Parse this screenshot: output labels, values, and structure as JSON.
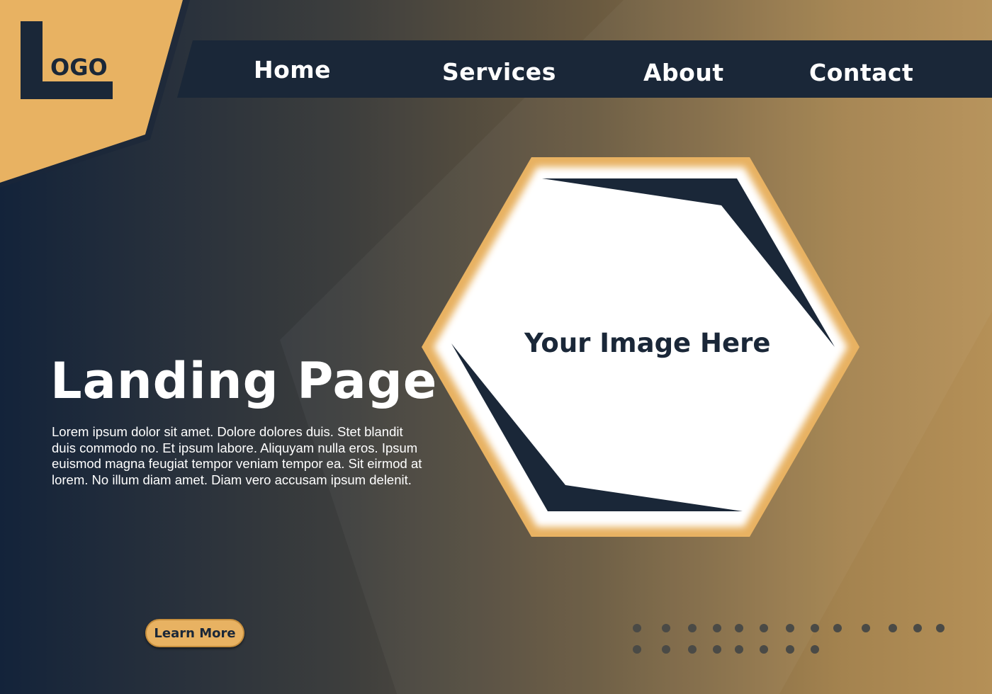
{
  "logo": {
    "text": "OGO",
    "alt": "Logo"
  },
  "nav": {
    "items": [
      "Home",
      "Services",
      "About",
      "Contact"
    ]
  },
  "hero": {
    "title": "Landing Page",
    "body": "Lorem ipsum dolor sit amet. Dolore dolores duis. Stet blandit duis commodo no. Et ipsum labore. Aliquyam nulla eros. Ipsum euismod magna feugiat tempor veniam tempor ea. Sit eirmod at lorem. No illum diam amet. Diam vero accusam ipsum delenit.",
    "button": "Learn More",
    "image_placeholder": "Your Image Here"
  },
  "colors": {
    "navy": "#1a2738",
    "gold": "#e8b262",
    "white": "#ffffff"
  }
}
